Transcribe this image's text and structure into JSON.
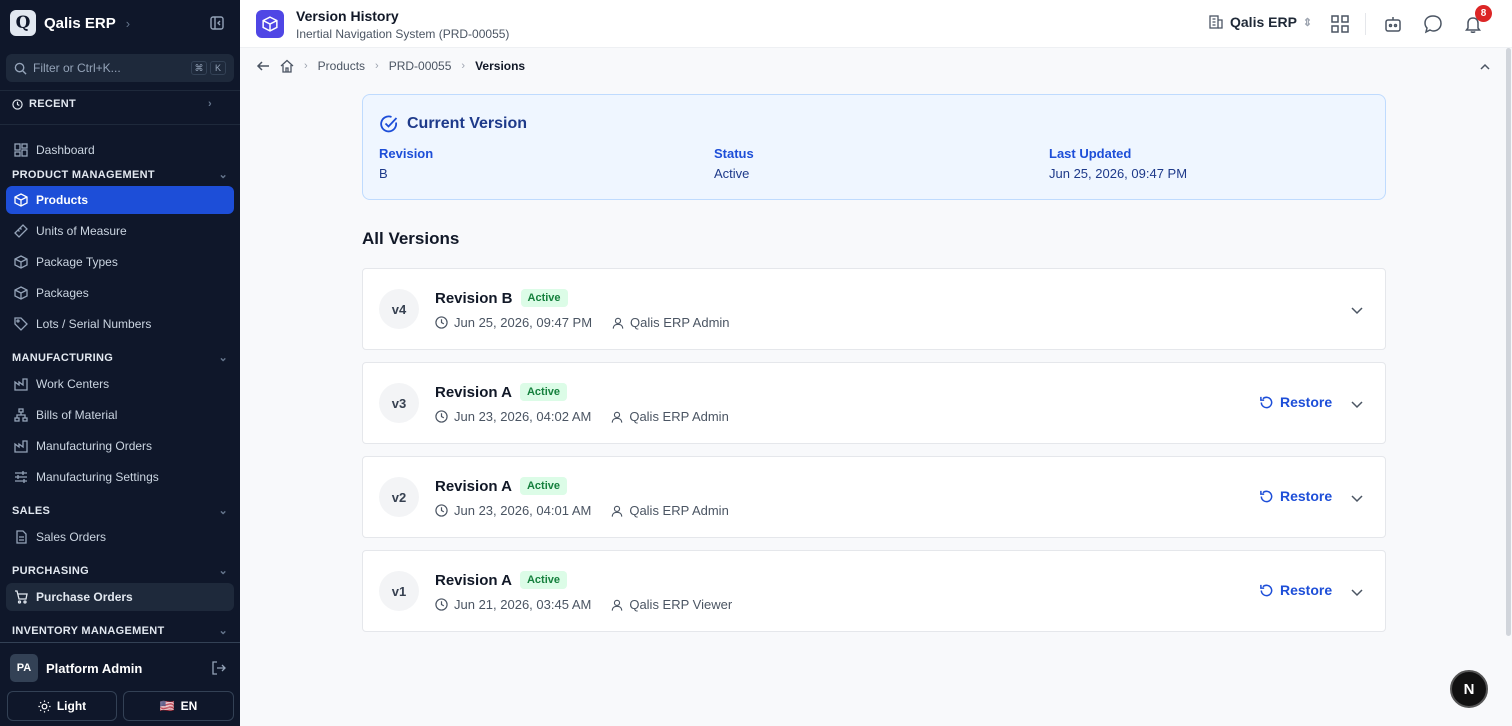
{
  "app": {
    "name": "Qalis ERP",
    "logo_letter": "Q"
  },
  "search": {
    "placeholder": "Filter or Ctrl+K...",
    "kbd1": "⌘",
    "kbd2": "K"
  },
  "recent": {
    "label": "RECENT"
  },
  "nav": {
    "dashboard": "Dashboard",
    "product_management": "PRODUCT MANAGEMENT",
    "products": "Products",
    "units": "Units of Measure",
    "package_types": "Package Types",
    "packages": "Packages",
    "lots": "Lots / Serial Numbers",
    "manufacturing": "MANUFACTURING",
    "work_centers": "Work Centers",
    "boms": "Bills of Material",
    "mfg_orders": "Manufacturing Orders",
    "mfg_settings": "Manufacturing Settings",
    "sales": "SALES",
    "sales_orders": "Sales Orders",
    "purchasing": "PURCHASING",
    "purchase_orders": "Purchase Orders",
    "inventory": "INVENTORY MANAGEMENT"
  },
  "user": {
    "initials": "PA",
    "name": "Platform Admin"
  },
  "bottom": {
    "theme": "Light",
    "lang": "EN",
    "flag": "🇺🇸"
  },
  "header": {
    "title": "Version History",
    "subtitle": "Inertial Navigation System (PRD-00055)",
    "org": "Qalis ERP",
    "notifications": "8"
  },
  "breadcrumb": {
    "products": "Products",
    "product_id": "PRD-00055",
    "current": "Versions"
  },
  "current_version": {
    "title": "Current Version",
    "revision_label": "Revision",
    "revision": "B",
    "status_label": "Status",
    "status": "Active",
    "updated_label": "Last Updated",
    "updated": "Jun 25, 2026, 09:47 PM"
  },
  "all_versions": {
    "title": "All Versions",
    "restore_label": "Restore"
  },
  "versions": [
    {
      "num": "v4",
      "revision": "Revision B",
      "status": "Active",
      "date": "Jun 25, 2026, 09:47 PM",
      "user": "Qalis ERP Admin"
    },
    {
      "num": "v3",
      "revision": "Revision A",
      "status": "Active",
      "date": "Jun 23, 2026, 04:02 AM",
      "user": "Qalis ERP Admin"
    },
    {
      "num": "v2",
      "revision": "Revision A",
      "status": "Active",
      "date": "Jun 23, 2026, 04:01 AM",
      "user": "Qalis ERP Admin"
    },
    {
      "num": "v1",
      "revision": "Revision A",
      "status": "Active",
      "date": "Jun 21, 2026, 03:45 AM",
      "user": "Qalis ERP Viewer"
    }
  ],
  "fab": {
    "label": "N"
  }
}
